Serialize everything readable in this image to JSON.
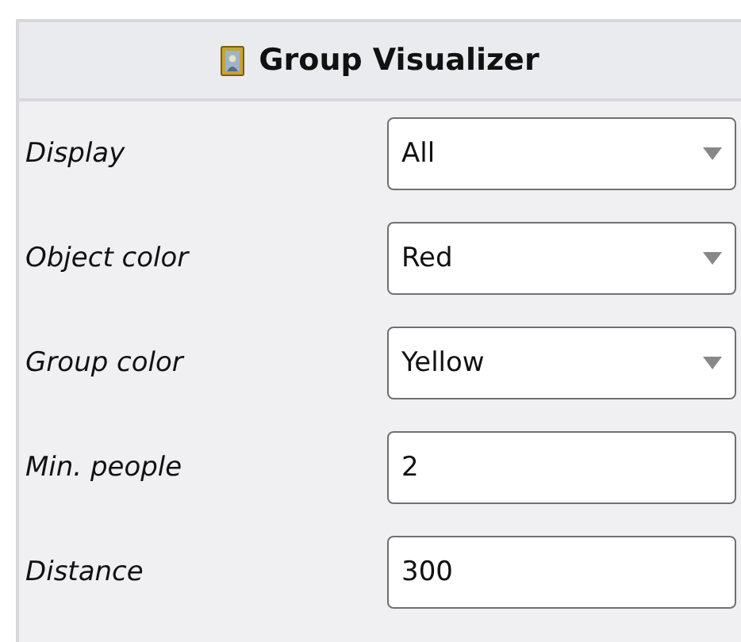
{
  "panel": {
    "title": "Group Visualizer"
  },
  "fields": [
    {
      "label": "Display",
      "kind": "dropdown",
      "value": "All"
    },
    {
      "label": "Object color",
      "kind": "dropdown",
      "value": "Red"
    },
    {
      "label": "Group color",
      "kind": "dropdown",
      "value": "Yellow"
    },
    {
      "label": "Min. people",
      "kind": "text",
      "value": "2"
    },
    {
      "label": "Distance",
      "kind": "text",
      "value": "300"
    }
  ]
}
